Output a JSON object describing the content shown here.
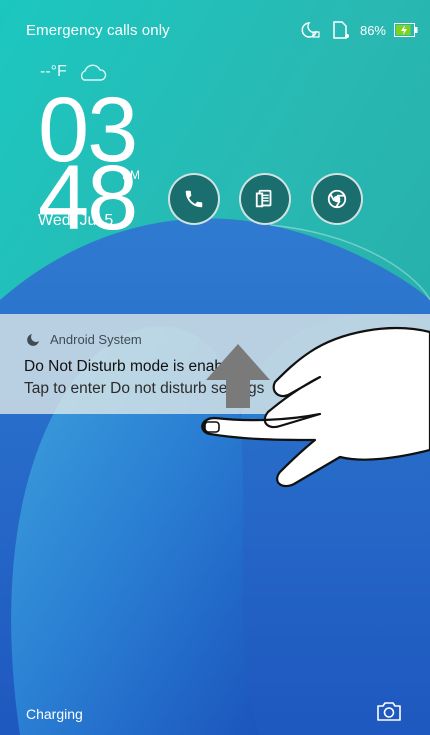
{
  "status_bar": {
    "carrier_text": "Emergency calls only",
    "battery_percent": "86%",
    "icons": [
      "do-not-disturb-moon-icon",
      "sim-card-icon",
      "battery-charging-icon"
    ],
    "battery_level": 0.86
  },
  "lockscreen": {
    "weather_temp": "--°F",
    "weather_icon": "cloud-icon",
    "clock_hours": "03",
    "clock_minutes": "48",
    "ampm": "PM",
    "date": "Wed, Jul 5",
    "shortcuts": [
      {
        "name": "phone",
        "icon": "phone-icon"
      },
      {
        "name": "messages",
        "icon": "messages-icon"
      },
      {
        "name": "chrome",
        "icon": "chrome-icon"
      }
    ]
  },
  "notification": {
    "app_name": "Android System",
    "app_icon": "moon-icon",
    "title": "Do Not Disturb mode is enabled",
    "body": "Tap to enter Do not disturb settings"
  },
  "bottom": {
    "charging_text": "Charging",
    "camera_icon": "camera-icon"
  },
  "colors": {
    "teal": "#28b8b3",
    "blue": "#1f63c7",
    "shortcut_bg": "#1a6e6d"
  }
}
